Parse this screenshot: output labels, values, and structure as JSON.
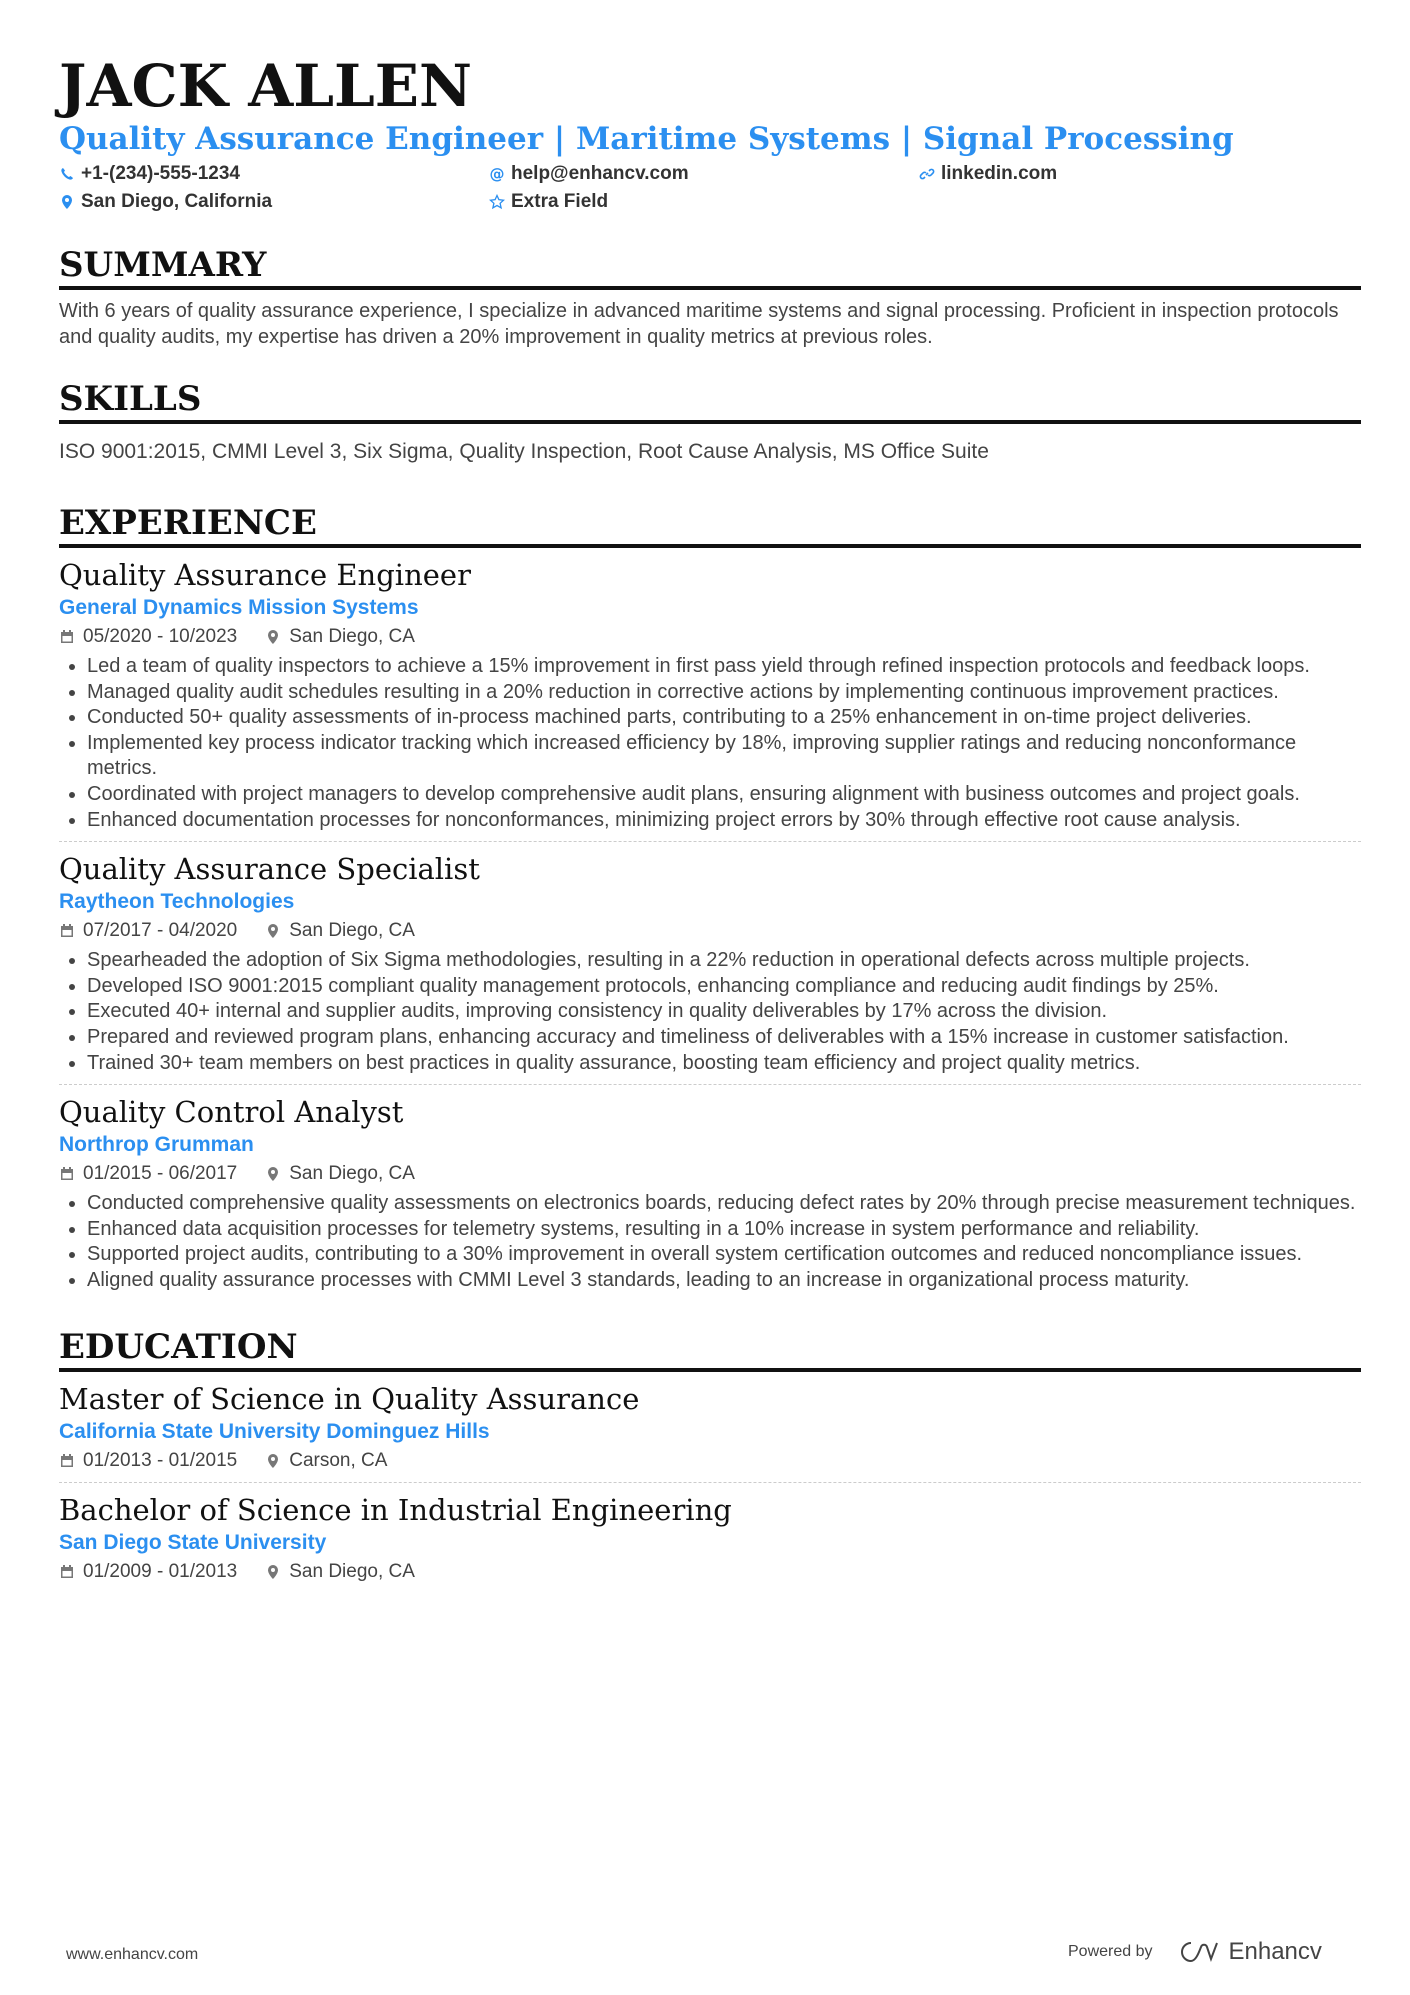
{
  "header": {
    "name": "JACK ALLEN",
    "title": "Quality Assurance Engineer | Maritime Systems | Signal Processing",
    "contacts": [
      {
        "icon": "phone-icon",
        "text": "+1-(234)-555-1234"
      },
      {
        "icon": "at-icon",
        "text": "help@enhancv.com"
      },
      {
        "icon": "link-icon",
        "text": "linkedin.com"
      },
      {
        "icon": "location-icon",
        "text": "San Diego, California"
      },
      {
        "icon": "star-icon",
        "text": "Extra Field"
      }
    ]
  },
  "summary": {
    "heading": "SUMMARY",
    "text": "With 6 years of quality assurance experience, I specialize in advanced maritime systems and signal processing. Proficient in inspection protocols and quality audits, my expertise has driven a 20% improvement in quality metrics at previous roles."
  },
  "skills": {
    "heading": "SKILLS",
    "text": "ISO 9001:2015, CMMI Level 3, Six Sigma, Quality Inspection, Root Cause Analysis, MS Office Suite"
  },
  "experience": {
    "heading": "EXPERIENCE",
    "entries": [
      {
        "role": "Quality Assurance Engineer",
        "company": "General Dynamics Mission Systems",
        "dates": "05/2020 - 10/2023",
        "location": "San Diego, CA",
        "bullets": [
          "Led a team of quality inspectors to achieve a 15% improvement in first pass yield through refined inspection protocols and feedback loops.",
          "Managed quality audit schedules resulting in a 20% reduction in corrective actions by implementing continuous improvement practices.",
          "Conducted 50+ quality assessments of in-process machined parts, contributing to a 25% enhancement in on-time project deliveries.",
          "Implemented key process indicator tracking which increased efficiency by 18%, improving supplier ratings and reducing nonconformance metrics.",
          "Coordinated with project managers to develop comprehensive audit plans, ensuring alignment with business outcomes and project goals.",
          "Enhanced documentation processes for nonconformances, minimizing project errors by 30% through effective root cause analysis."
        ]
      },
      {
        "role": "Quality Assurance Specialist",
        "company": "Raytheon Technologies",
        "dates": "07/2017 - 04/2020",
        "location": "San Diego, CA",
        "bullets": [
          "Spearheaded the adoption of Six Sigma methodologies, resulting in a 22% reduction in operational defects across multiple projects.",
          "Developed ISO 9001:2015 compliant quality management protocols, enhancing compliance and reducing audit findings by 25%.",
          "Executed 40+ internal and supplier audits, improving consistency in quality deliverables by 17% across the division.",
          "Prepared and reviewed program plans, enhancing accuracy and timeliness of deliverables with a 15% increase in customer satisfaction.",
          "Trained 30+ team members on best practices in quality assurance, boosting team efficiency and project quality metrics."
        ]
      },
      {
        "role": "Quality Control Analyst",
        "company": "Northrop Grumman",
        "dates": "01/2015 - 06/2017",
        "location": "San Diego, CA",
        "bullets": [
          "Conducted comprehensive quality assessments on electronics boards, reducing defect rates by 20% through precise measurement techniques.",
          "Enhanced data acquisition processes for telemetry systems, resulting in a 10% increase in system performance and reliability.",
          "Supported project audits, contributing to a 30% improvement in overall system certification outcomes and reduced noncompliance issues.",
          "Aligned quality assurance processes with CMMI Level 3 standards, leading to an increase in organizational process maturity."
        ]
      }
    ]
  },
  "education": {
    "heading": "EDUCATION",
    "entries": [
      {
        "degree": "Master of Science in Quality Assurance",
        "school": "California State University Dominguez Hills",
        "dates": "01/2013 - 01/2015",
        "location": "Carson, CA"
      },
      {
        "degree": "Bachelor of Science in Industrial Engineering",
        "school": "San Diego State University",
        "dates": "01/2009 - 01/2013",
        "location": "San Diego, CA"
      }
    ]
  },
  "footer": {
    "website": "www.enhancv.com",
    "powered_by": "Powered by",
    "brand": "Enhancv"
  },
  "colors": {
    "accent": "#2b8ff0",
    "heading": "#111111",
    "body": "#444444"
  }
}
